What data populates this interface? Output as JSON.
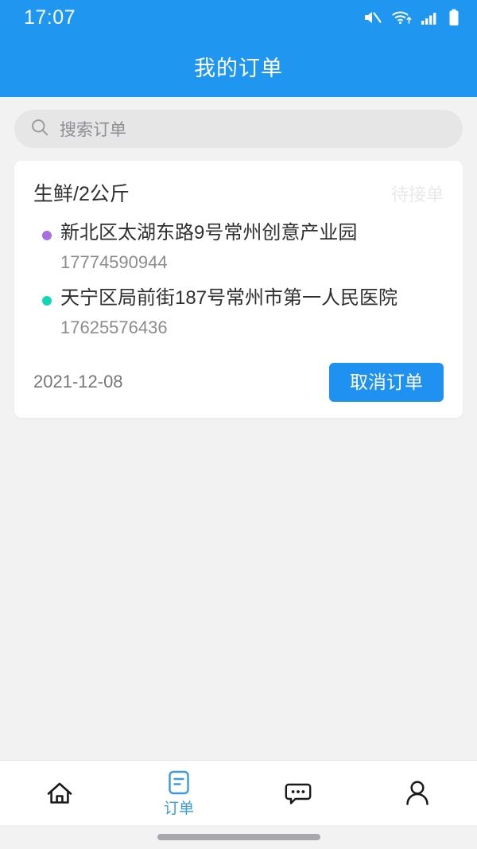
{
  "status_bar": {
    "time": "17:07",
    "icons": [
      "mute-icon",
      "wifi-icon",
      "signal-icon",
      "battery-icon"
    ]
  },
  "header": {
    "title": "我的订单",
    "background_color": "#1f96f0"
  },
  "search": {
    "placeholder": "搜索订单",
    "value": "",
    "icon": "search-icon"
  },
  "order_card": {
    "title": "生鲜/2公斤",
    "status": "待接单",
    "status_color": "#e9e9ea",
    "addresses": [
      {
        "type": "pickup",
        "bullet_color": "#a86fe0",
        "address": "新北区太湖东路9号常州创意产业园",
        "phone": "17774590944"
      },
      {
        "type": "dropoff",
        "bullet_color": "#10d6b5",
        "address": "天宁区局前街187号常州市第一人民医院",
        "phone": "17625576436"
      }
    ],
    "date": "2021-12-08",
    "cancel_label": "取消订单",
    "cancel_color": "#1f91f0"
  },
  "tabbar": {
    "active_color": "#3a9ae0",
    "inactive_color": "#1a1a1a",
    "items": [
      {
        "name": "home",
        "icon": "home-icon",
        "label": "",
        "active": false
      },
      {
        "name": "orders",
        "icon": "document-icon",
        "label": "订单",
        "active": true
      },
      {
        "name": "messages",
        "icon": "chat-bubble-icon",
        "label": "",
        "active": false
      },
      {
        "name": "profile",
        "icon": "person-icon",
        "label": "",
        "active": false
      }
    ]
  }
}
